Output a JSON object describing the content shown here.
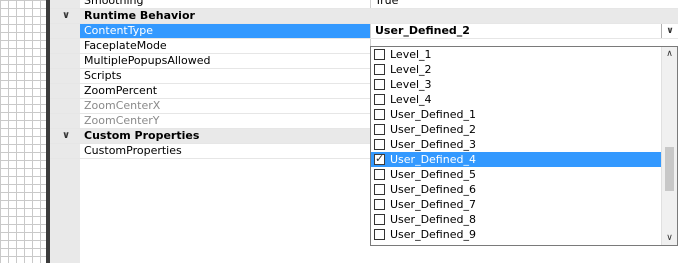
{
  "rows": {
    "smoothing": {
      "name": "Smoothing",
      "value": "True"
    },
    "cat_runtime": {
      "label": "Runtime Behavior"
    },
    "content_type": {
      "name": "ContentType",
      "value": "User_Defined_2"
    },
    "faceplate_mode": {
      "name": "FaceplateMode"
    },
    "multiple_popups": {
      "name": "MultiplePopupsAllowed"
    },
    "scripts": {
      "name": "Scripts"
    },
    "zoom_percent": {
      "name": "ZoomPercent"
    },
    "zoom_center_x": {
      "name": "ZoomCenterX"
    },
    "zoom_center_y": {
      "name": "ZoomCenterY"
    },
    "cat_custom": {
      "label": "Custom Properties"
    },
    "custom_properties": {
      "name": "CustomProperties"
    }
  },
  "dropdown": {
    "items": [
      {
        "label": "Level_1",
        "checked": false
      },
      {
        "label": "Level_2",
        "checked": false
      },
      {
        "label": "Level_3",
        "checked": false
      },
      {
        "label": "Level_4",
        "checked": false
      },
      {
        "label": "User_Defined_1",
        "checked": false
      },
      {
        "label": "User_Defined_2",
        "checked": false
      },
      {
        "label": "User_Defined_3",
        "checked": false
      },
      {
        "label": "User_Defined_4",
        "checked": true
      },
      {
        "label": "User_Defined_5",
        "checked": false
      },
      {
        "label": "User_Defined_6",
        "checked": false
      },
      {
        "label": "User_Defined_7",
        "checked": false
      },
      {
        "label": "User_Defined_8",
        "checked": false
      },
      {
        "label": "User_Defined_9",
        "checked": false
      }
    ],
    "selected_index": 7
  },
  "colors": {
    "selection": "#3399ff",
    "category_bg": "#e9e9e9"
  }
}
